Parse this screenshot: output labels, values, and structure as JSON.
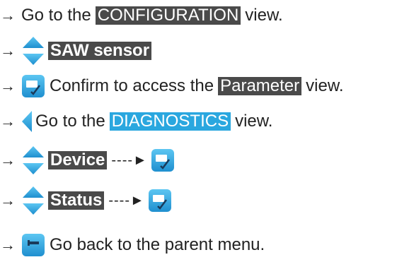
{
  "lines": [
    {
      "prefix": "→",
      "before": "Go to the",
      "hl": "CONFIGURATION",
      "after": "view."
    },
    {
      "prefix": "→",
      "hl": "SAW sensor"
    },
    {
      "prefix": "→",
      "text": "Confirm to access the",
      "hl": "Parameter",
      "after": "view."
    },
    {
      "prefix": "→",
      "text": "Go to the",
      "hl": "DIAGNOSTICS",
      "after": "view."
    },
    {
      "prefix": "→",
      "hl": "Device",
      "dash": "----►"
    },
    {
      "prefix": "→",
      "hl": "Status",
      "dash": "----►"
    },
    {
      "prefix": "→",
      "text": "Go back to the parent menu."
    }
  ],
  "icons": {
    "updown": "up-down-arrow-icon",
    "confirm": "confirm-check-icon",
    "left": "left-arrow-icon",
    "back": "back-arrow-icon"
  },
  "colors": {
    "blue": "#2aa7df",
    "dark": "#4a4a4a"
  }
}
